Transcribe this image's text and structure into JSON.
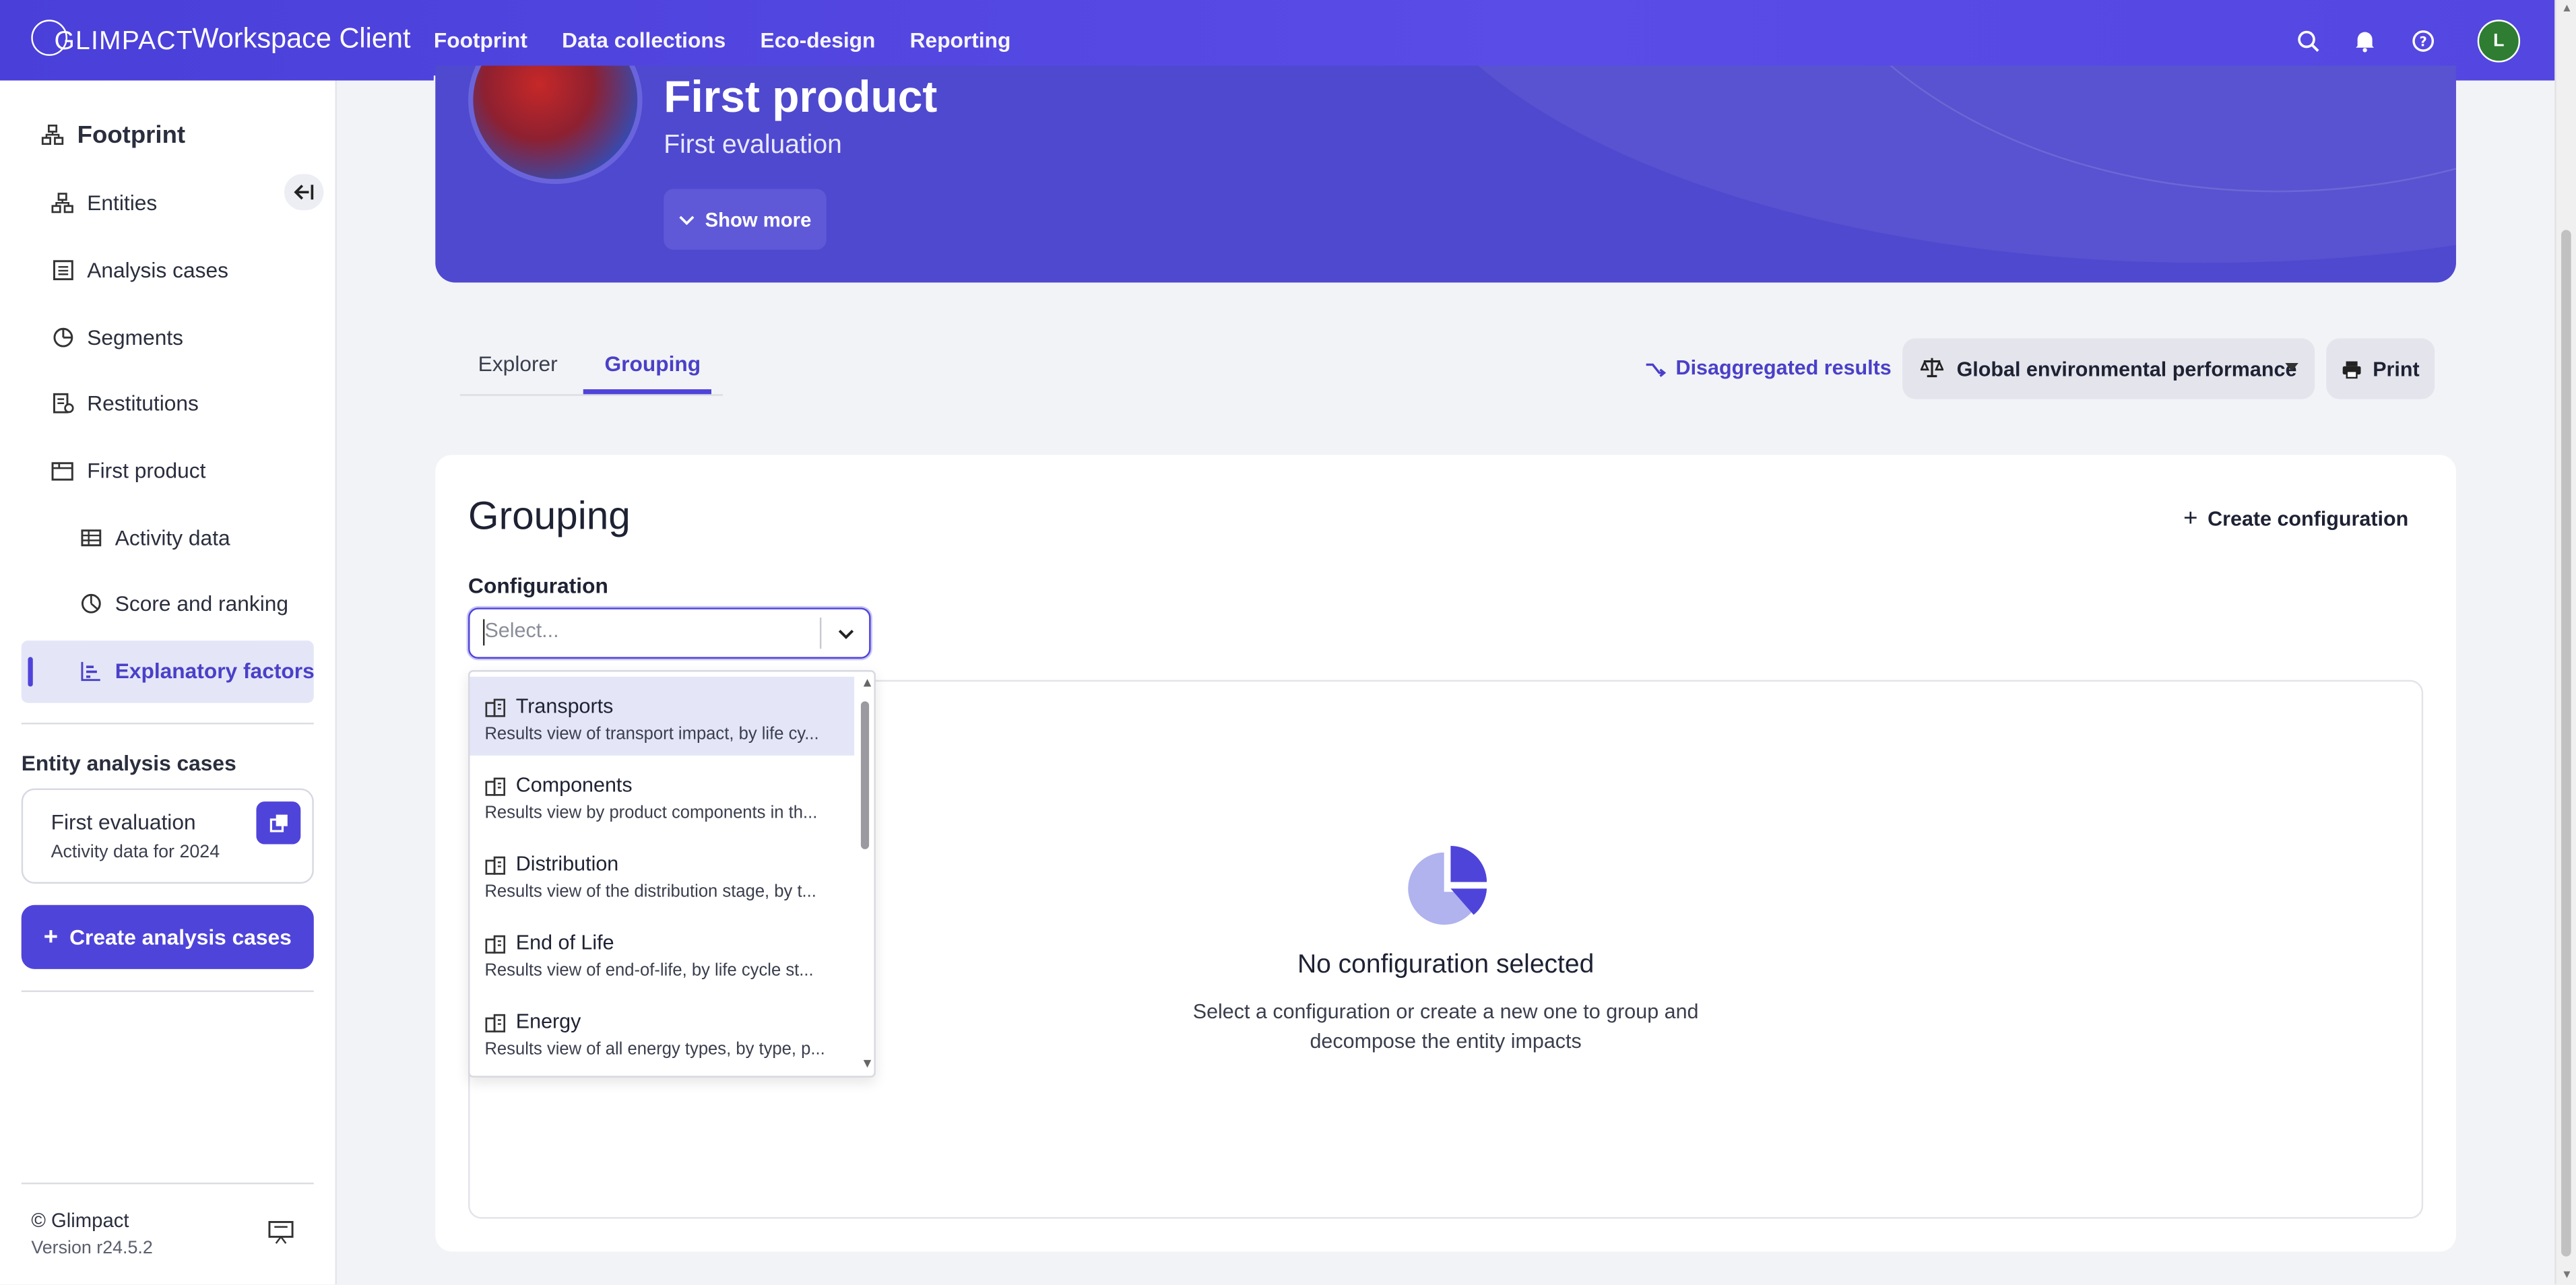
{
  "topbar": {
    "logo": "GLIMPACT",
    "app_name": "Workspace Client",
    "nav": [
      "Footprint",
      "Data collections",
      "Eco-design",
      "Reporting"
    ],
    "avatar_initial": "L"
  },
  "sidebar": {
    "title": "Footprint",
    "items": [
      {
        "label": "Entities",
        "icon": "entities-icon"
      },
      {
        "label": "Analysis cases",
        "icon": "list-icon"
      },
      {
        "label": "Segments",
        "icon": "pie-icon"
      },
      {
        "label": "Restitutions",
        "icon": "report-icon"
      },
      {
        "label": "First product",
        "icon": "product-icon"
      },
      {
        "label": "Activity data",
        "icon": "table-icon"
      },
      {
        "label": "Score and ranking",
        "icon": "score-icon"
      },
      {
        "label": "Explanatory factors",
        "icon": "chart-icon"
      }
    ],
    "section_title": "Entity analysis cases",
    "case": {
      "name": "First evaluation",
      "sub": "Activity data for 2024"
    },
    "create_cases": "Create analysis cases",
    "copyright": "© Glimpact",
    "version": "Version r24.5.2"
  },
  "banner": {
    "title": "First product",
    "subtitle": "First evaluation",
    "show_more": "Show more"
  },
  "tabs": [
    "Explorer",
    "Grouping"
  ],
  "actions": {
    "disaggregated": "Disaggregated results",
    "global": "Global environmental performance",
    "print": "Print"
  },
  "grouping": {
    "title": "Grouping",
    "create_config": "Create configuration",
    "config_label": "Configuration",
    "placeholder": "Select...",
    "empty_title": "No configuration selected",
    "empty_desc": "Select a configuration or create a new one to group and decompose the entity impacts"
  },
  "dropdown": {
    "options": [
      {
        "label": "Transports",
        "desc": "Results view of transport impact, by life cy..."
      },
      {
        "label": "Components",
        "desc": "Results view by product components in th..."
      },
      {
        "label": "Distribution",
        "desc": "Results view of the distribution stage, by t..."
      },
      {
        "label": "End of Life",
        "desc": "Results view of end-of-life, by life cycle st..."
      },
      {
        "label": "Energy",
        "desc": "Results view of all energy types, by type, p..."
      }
    ]
  },
  "colors": {
    "primary": "#4f44d9",
    "banner": "#4f49cf",
    "avatar": "#2e7d32"
  }
}
